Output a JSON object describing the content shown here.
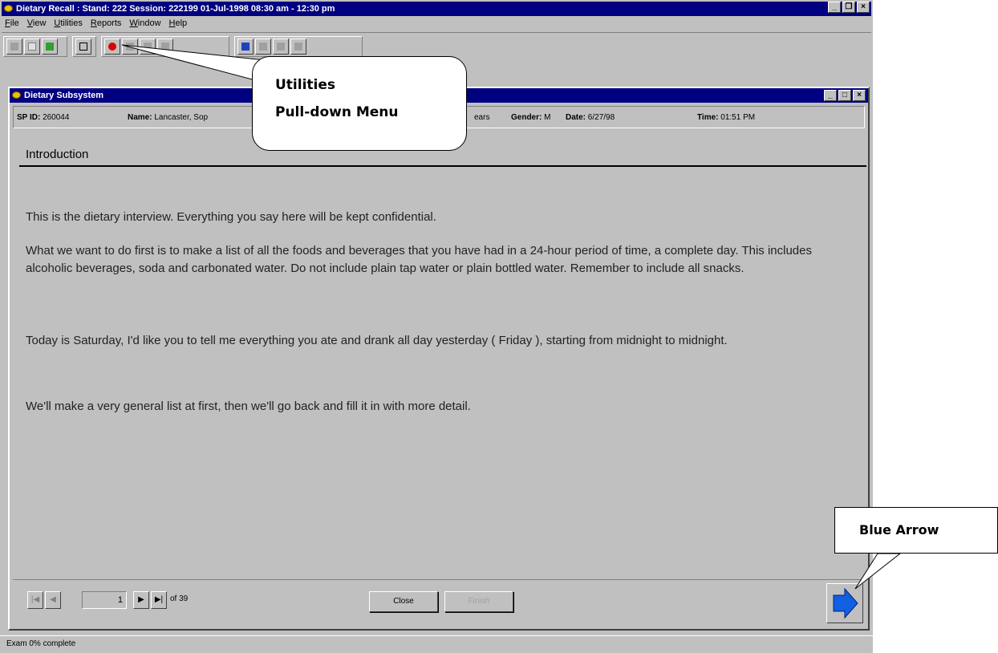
{
  "app": {
    "title": "Dietary Recall : Stand: 222 Session: 222199 01-Jul-1998 08:30 am - 12:30 pm",
    "menus": [
      {
        "pre": "",
        "ul": "F",
        "post": "ile"
      },
      {
        "pre": "",
        "ul": "V",
        "post": "iew"
      },
      {
        "pre": "",
        "ul": "U",
        "post": "tilities"
      },
      {
        "pre": "",
        "ul": "R",
        "post": "eports"
      },
      {
        "pre": "",
        "ul": "W",
        "post": "indow"
      },
      {
        "pre": "",
        "ul": "H",
        "post": "elp"
      }
    ],
    "status": "Exam 0% complete"
  },
  "child": {
    "title": "Dietary Subsystem",
    "sp_id_label": "SP ID:",
    "sp_id": "260044",
    "name_label": "Name:",
    "name": "Lancaster, Sop",
    "age_fragment": "ears",
    "gender_label": "Gender:",
    "gender": "M",
    "date_label": "Date:",
    "date": "6/27/98",
    "time_label": "Time:",
    "time": "01:51 PM"
  },
  "content": {
    "section_title": "Introduction",
    "paragraphs": [
      "This is the dietary interview.  Everything you say here will be kept confidential.",
      "What we want to do first is to make a list of all the foods and beverages that you have had in a 24-hour period of time, a complete day.  This includes alcoholic beverages, soda and carbonated water.  Do not include plain tap water or plain bottled water.  Remember to include all snacks.",
      "Today is Saturday, I'd like you to tell me everything you ate and drank all day yesterday ( Friday ), starting from midnight to midnight.",
      "We'll make a very general list at first, then we'll go back and fill it in with more detail."
    ]
  },
  "nav": {
    "page": "1",
    "of_label": "of 39",
    "close_label": "Close",
    "finish_label": "Finish"
  },
  "callouts": {
    "utilities_line1": "Utilities",
    "utilities_line2": "Pull-down Menu",
    "blue_arrow": "Blue Arrow"
  },
  "colors": {
    "titlebar": "#000080",
    "window": "#c0c0c0",
    "arrow": "#1060e0"
  }
}
